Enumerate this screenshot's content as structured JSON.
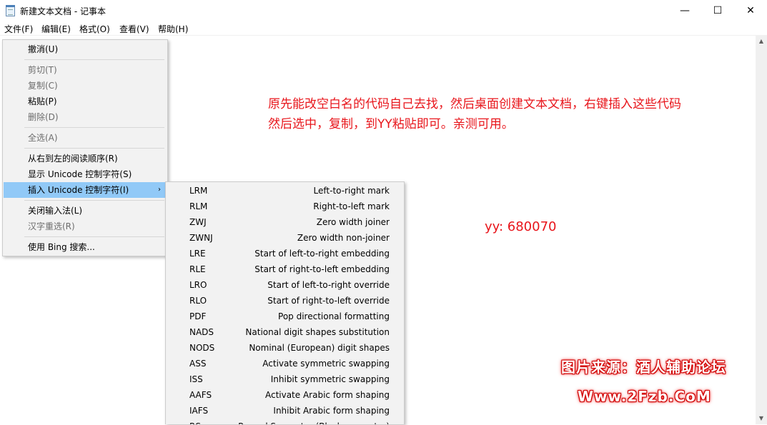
{
  "window": {
    "title": "新建文本文档 - 记事本",
    "minimize": "—",
    "maximize": "☐",
    "close": "✕"
  },
  "menubar": [
    "文件(F)",
    "编辑(E)",
    "格式(O)",
    "查看(V)",
    "帮助(H)"
  ],
  "context_menu": {
    "undo": "撤消(U)",
    "cut": "剪切(T)",
    "copy": "复制(C)",
    "paste": "粘贴(P)",
    "delete": "删除(D)",
    "select_all": "全选(A)",
    "rtl": "从右到左的阅读顺序(R)",
    "show_unicode": "显示 Unicode 控制字符(S)",
    "insert_unicode": "插入 Unicode 控制字符(I)",
    "close_ime": "关闭输入法(L)",
    "reconversion": "汉字重选(R)",
    "bing": "使用 Bing 搜索..."
  },
  "submenu": [
    {
      "code": "LRM",
      "desc": "Left-to-right mark"
    },
    {
      "code": "RLM",
      "desc": "Right-to-left mark"
    },
    {
      "code": "ZWJ",
      "desc": "Zero width joiner"
    },
    {
      "code": "ZWNJ",
      "desc": "Zero width non-joiner"
    },
    {
      "code": "LRE",
      "desc": "Start of left-to-right embedding"
    },
    {
      "code": "RLE",
      "desc": "Start of right-to-left embedding"
    },
    {
      "code": "LRO",
      "desc": "Start of left-to-right override"
    },
    {
      "code": "RLO",
      "desc": "Start of right-to-left override"
    },
    {
      "code": "PDF",
      "desc": "Pop directional formatting"
    },
    {
      "code": "NADS",
      "desc": "National digit shapes substitution"
    },
    {
      "code": "NODS",
      "desc": "Nominal (European) digit shapes"
    },
    {
      "code": "ASS",
      "desc": "Activate symmetric swapping"
    },
    {
      "code": "ISS",
      "desc": "Inhibit symmetric swapping"
    },
    {
      "code": "AAFS",
      "desc": "Activate Arabic form shaping"
    },
    {
      "code": "IAFS",
      "desc": "Inhibit Arabic form shaping"
    },
    {
      "code": "RS",
      "desc": "Record Separator (Block separator)"
    }
  ],
  "document": {
    "line1": "原先能改空白名的代码自己去找，然后桌面创建文本文档，右键插入这些代码",
    "line2": "然后选中，复制，到YY粘贴即可。亲测可用。",
    "yy": "yy: 680070"
  },
  "watermark": {
    "line1": "图片来源：酒人辅助论坛",
    "line2": "Www.2Fzb.CoM"
  },
  "colors": {
    "annotation_red": "#e8151b",
    "highlight": "#91c9f7"
  }
}
